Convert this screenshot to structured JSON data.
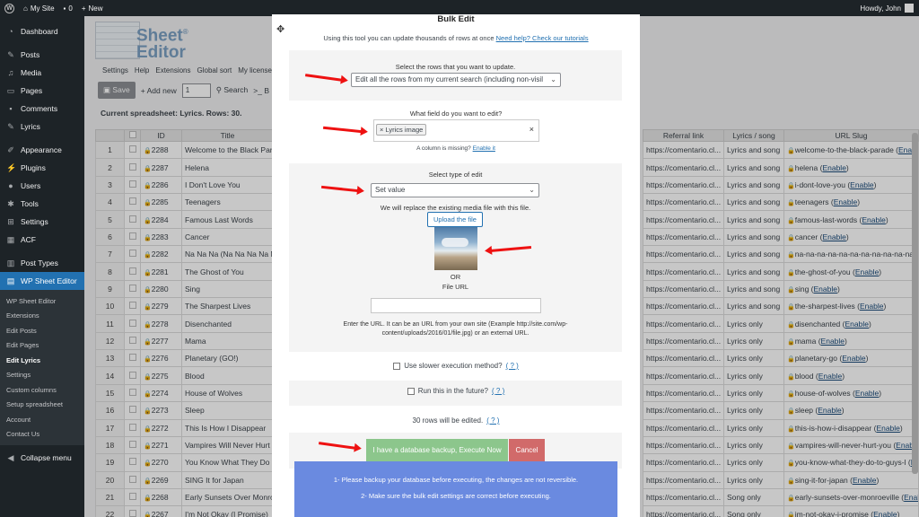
{
  "adminbar": {
    "site_name": "My Site",
    "comments_count": "0",
    "new_label": "New",
    "howdy": "Howdy, John"
  },
  "sidebar": {
    "items": [
      {
        "label": "Dashboard",
        "icon": "dashboard-icon"
      },
      {
        "label": "Posts",
        "icon": "pushpin-icon"
      },
      {
        "label": "Media",
        "icon": "media-icon"
      },
      {
        "label": "Pages",
        "icon": "page-icon"
      },
      {
        "label": "Comments",
        "icon": "comment-icon"
      },
      {
        "label": "Lyrics",
        "icon": "pushpin-icon"
      },
      {
        "label": "Appearance",
        "icon": "paintbrush-icon"
      },
      {
        "label": "Plugins",
        "icon": "plug-icon"
      },
      {
        "label": "Users",
        "icon": "user-icon"
      },
      {
        "label": "Tools",
        "icon": "wrench-icon"
      },
      {
        "label": "Settings",
        "icon": "settings-icon"
      },
      {
        "label": "ACF",
        "icon": "acf-icon"
      },
      {
        "label": "Post Types",
        "icon": "post-types-icon"
      },
      {
        "label": "WP Sheet Editor",
        "icon": "sheet-editor-icon"
      }
    ],
    "submenu": [
      "WP Sheet Editor",
      "Extensions",
      "Edit Posts",
      "Edit Pages",
      "Edit Lyrics",
      "Settings",
      "Custom columns",
      "Setup spreadsheet",
      "Account",
      "Contact Us"
    ],
    "collapse": "Collapse menu"
  },
  "main": {
    "logo_line1": "Sheet",
    "logo_line2": "Editor",
    "logo_reg": "®",
    "nav": [
      "Settings",
      "Help",
      "Extensions",
      "Global sort",
      "My license"
    ],
    "toolbar": {
      "save": "Save",
      "add_new": "+ Add new",
      "add_qty": "1",
      "search": "Search",
      "more": ">_ B"
    },
    "current_sheet": "Current spreadsheet: Lyrics. Rows: 30."
  },
  "grid": {
    "left_headers": [
      "",
      "",
      "ID",
      "Title"
    ],
    "right_headers": [
      "Referral link",
      "Lyrics / song",
      "URL Slug"
    ],
    "enable": "Enable",
    "rows": [
      {
        "n": "1",
        "id": "2288",
        "title": "Welcome to the Black Parade",
        "ref": "https://comentario.cl...",
        "type": "Lyrics and song",
        "slug": "welcome-to-the-black-parade"
      },
      {
        "n": "2",
        "id": "2287",
        "title": "Helena",
        "ref": "https://comentario.cl...",
        "type": "Lyrics and song",
        "slug": "helena"
      },
      {
        "n": "3",
        "id": "2286",
        "title": "I Don't Love You",
        "ref": "https://comentario.cl...",
        "type": "Lyrics and song",
        "slug": "i-dont-love-you"
      },
      {
        "n": "4",
        "id": "2285",
        "title": "Teenagers",
        "ref": "https://comentario.cl...",
        "type": "Lyrics and song",
        "slug": "teenagers"
      },
      {
        "n": "5",
        "id": "2284",
        "title": "Famous Last Words",
        "ref": "https://comentario.cl...",
        "type": "Lyrics and song",
        "slug": "famous-last-words"
      },
      {
        "n": "6",
        "id": "2283",
        "title": "Cancer",
        "ref": "https://comentario.cl...",
        "type": "Lyrics and song",
        "slug": "cancer"
      },
      {
        "n": "7",
        "id": "2282",
        "title": "Na Na Na (Na Na Na Na Na",
        "ref": "https://comentario.cl...",
        "type": "Lyrics and song",
        "slug": "na-na-na-na-na-na-na-na-na-na-na-na-m"
      },
      {
        "n": "8",
        "id": "2281",
        "title": "The Ghost of You",
        "ref": "https://comentario.cl...",
        "type": "Lyrics and song",
        "slug": "the-ghost-of-you"
      },
      {
        "n": "9",
        "id": "2280",
        "title": "Sing",
        "ref": "https://comentario.cl...",
        "type": "Lyrics and song",
        "slug": "sing"
      },
      {
        "n": "10",
        "id": "2279",
        "title": "The Sharpest Lives",
        "ref": "https://comentario.cl...",
        "type": "Lyrics and song",
        "slug": "the-sharpest-lives"
      },
      {
        "n": "11",
        "id": "2278",
        "title": "Disenchanted",
        "ref": "https://comentario.cl...",
        "type": "Lyrics only",
        "slug": "disenchanted"
      },
      {
        "n": "12",
        "id": "2277",
        "title": "Mama",
        "ref": "https://comentario.cl...",
        "type": "Lyrics only",
        "slug": "mama"
      },
      {
        "n": "13",
        "id": "2276",
        "title": "Planetary (GO!)",
        "ref": "https://comentario.cl...",
        "type": "Lyrics only",
        "slug": "planetary-go"
      },
      {
        "n": "14",
        "id": "2275",
        "title": "Blood",
        "ref": "https://comentario.cl...",
        "type": "Lyrics only",
        "slug": "blood"
      },
      {
        "n": "15",
        "id": "2274",
        "title": "House of Wolves",
        "ref": "https://comentario.cl...",
        "type": "Lyrics only",
        "slug": "house-of-wolves"
      },
      {
        "n": "16",
        "id": "2273",
        "title": "Sleep",
        "ref": "https://comentario.cl...",
        "type": "Lyrics only",
        "slug": "sleep"
      },
      {
        "n": "17",
        "id": "2272",
        "title": "This Is How I Disappear",
        "ref": "https://comentario.cl...",
        "type": "Lyrics only",
        "slug": "this-is-how-i-disappear"
      },
      {
        "n": "18",
        "id": "2271",
        "title": "Vampires Will Never Hurt Y",
        "ref": "https://comentario.cl...",
        "type": "Lyrics only",
        "slug": "vampires-will-never-hurt-you"
      },
      {
        "n": "19",
        "id": "2270",
        "title": "You Know What They Do to",
        "ref": "https://comentario.cl...",
        "type": "Lyrics only",
        "slug": "you-know-what-they-do-to-guys-l"
      },
      {
        "n": "20",
        "id": "2269",
        "title": "SING It for Japan",
        "ref": "https://comentario.cl...",
        "type": "Lyrics only",
        "slug": "sing-it-for-japan"
      },
      {
        "n": "21",
        "id": "2268",
        "title": "Early Sunsets Over Monroe",
        "ref": "https://comentario.cl...",
        "type": "Song only",
        "slug": "early-sunsets-over-monroeville"
      },
      {
        "n": "22",
        "id": "2267",
        "title": "I'm Not Okay (I Promise)",
        "ref": "https://comentario.cl...",
        "type": "Song only",
        "slug": "im-not-okay-i-promise"
      }
    ]
  },
  "modal": {
    "title": "Bulk Edit",
    "intro": "Using this tool you can update thousands of rows at once",
    "help_link": "Need help? Check our tutorials",
    "rows_label": "Select the rows that you want to update.",
    "rows_select": "Edit all the rows from my current search (including non-visil",
    "field_label": "What field do you want to edit?",
    "field_tag": "× Lyrics image",
    "field_clear": "×",
    "missing_text": "A column is missing?",
    "enable_it": "Enable it",
    "edit_type_label": "Select type of edit",
    "edit_type_select": "Set value",
    "replace_text": "We will replace the existing media file with this file.",
    "upload_button": "Upload the file",
    "or_text": "OR",
    "file_url_label": "File URL",
    "url_help_1": "Enter the URL. It can be an URL from your own site (Example http://site.com/wp-",
    "url_help_2": "content/uploads/2016/01/file.jpg) or an external URL.",
    "slower_label": "Use slower execution method?",
    "future_label": "Run this in the future?",
    "help_q": "( ? )",
    "rows_edited": "30 rows will be edited.",
    "execute_button": "I have a database backup, Execute Now",
    "cancel_button": "Cancel",
    "warning_1": "1- Please backup your database before executing, the changes are not reversible.",
    "warning_2": "2- Make sure the bulk edit settings are correct before executing."
  },
  "colors": {
    "admin_dark": "#1d2327",
    "wp_blue": "#2271b1",
    "execute_green": "#8cc68c",
    "cancel_red": "#d16a6a",
    "warning_blue": "#6a8ae0",
    "arrow_red": "#ee1111"
  }
}
